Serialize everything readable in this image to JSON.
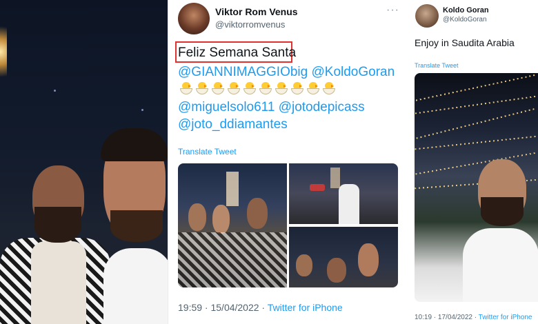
{
  "middle_tweet": {
    "author_name": "Viktor Rom Venus",
    "author_handle": "@viktorromvenus",
    "more_icon": "more-icon",
    "text_line1": "Feliz Semana Santa",
    "mentions_line1": "@GIANNIMAGGIObig @KoldoGoran",
    "emoji_name": "hatching-chick-emoji",
    "emoji_count": 10,
    "mentions_line2": "@miguelsolo611 @jotodepicass",
    "mentions_line3": "@joto_ddiamantes",
    "translate": "Translate Tweet",
    "timestamp": "19:59 · 15/04/2022 · ",
    "source": "Twitter for iPhone",
    "highlight_color": "#e0312e"
  },
  "right_tweet": {
    "author_name": "Koldo Goran",
    "author_handle": "@KoldoGoran",
    "text": "Enjoy in Saudita Arabia",
    "translate": "Translate Tweet",
    "timestamp": "10:19 · 17/04/2022 · ",
    "source": "Twitter for iPhone"
  },
  "colors": {
    "link": "#1d9bf0",
    "text": "#0f1419",
    "secondary": "#536471"
  }
}
